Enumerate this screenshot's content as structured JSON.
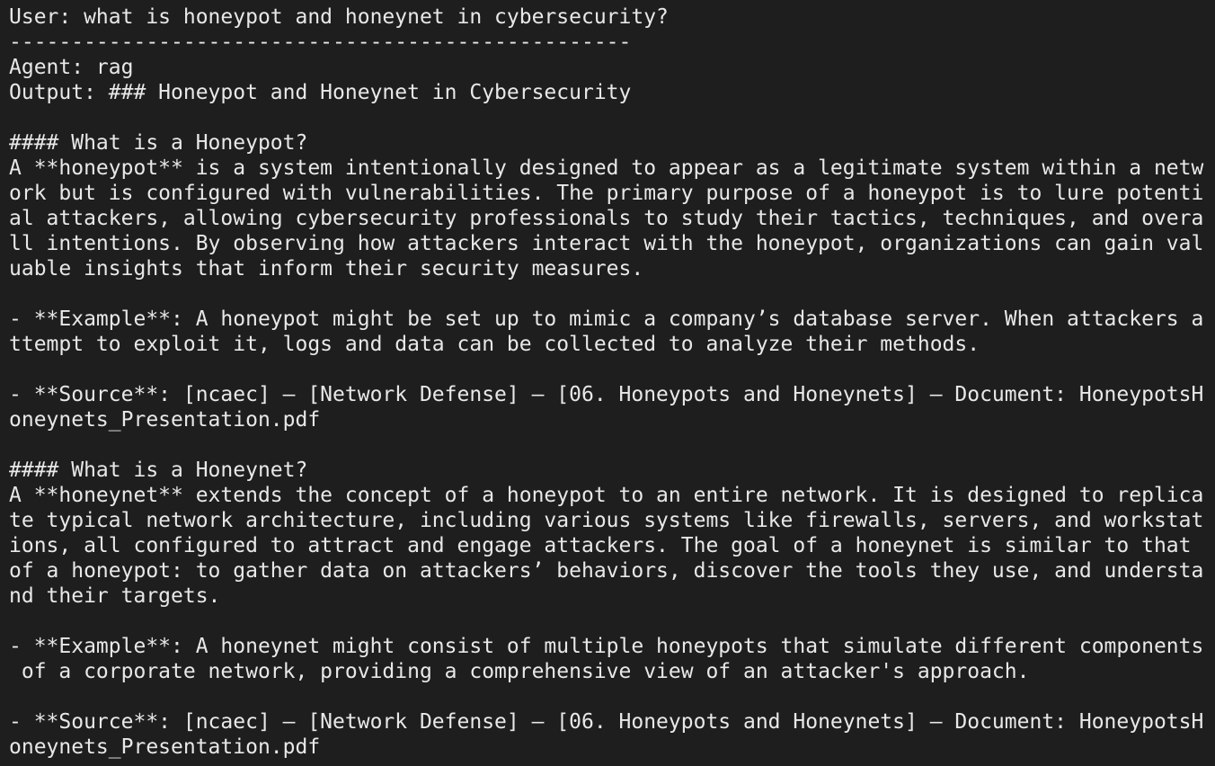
{
  "terminal": {
    "lines": [
      "User: what is honeypot and honeynet in cybersecurity?",
      "--------------------------------------------------",
      "Agent: rag",
      "Output: ### Honeypot and Honeynet in Cybersecurity",
      "",
      "#### What is a Honeypot?",
      "A **honeypot** is a system intentionally designed to appear as a legitimate system within a netw",
      "ork but is configured with vulnerabilities. The primary purpose of a honeypot is to lure potenti",
      "al attackers, allowing cybersecurity professionals to study their tactics, techniques, and overa",
      "ll intentions. By observing how attackers interact with the honeypot, organizations can gain val",
      "uable insights that inform their security measures.",
      "",
      "- **Example**: A honeypot might be set up to mimic a company’s database server. When attackers a",
      "ttempt to exploit it, logs and data can be collected to analyze their methods.",
      "",
      "- **Source**: [ncaec] – [Network Defense] – [06. Honeypots and Honeynets] – Document: HoneypotsH",
      "oneynets_Presentation.pdf",
      "",
      "#### What is a Honeynet?",
      "A **honeynet** extends the concept of a honeypot to an entire network. It is designed to replica",
      "te typical network architecture, including various systems like firewalls, servers, and workstat",
      "ions, all configured to attract and engage attackers. The goal of a honeynet is similar to that ",
      "of a honeypot: to gather data on attackers’ behaviors, discover the tools they use, and understa",
      "nd their targets.",
      "",
      "- **Example**: A honeynet might consist of multiple honeypots that simulate different components",
      " of a corporate network, providing a comprehensive view of an attacker's approach.",
      "",
      "- **Source**: [ncaec] – [Network Defense] – [06. Honeypots and Honeynets] – Document: HoneypotsH",
      "oneynets_Presentation.pdf"
    ]
  }
}
